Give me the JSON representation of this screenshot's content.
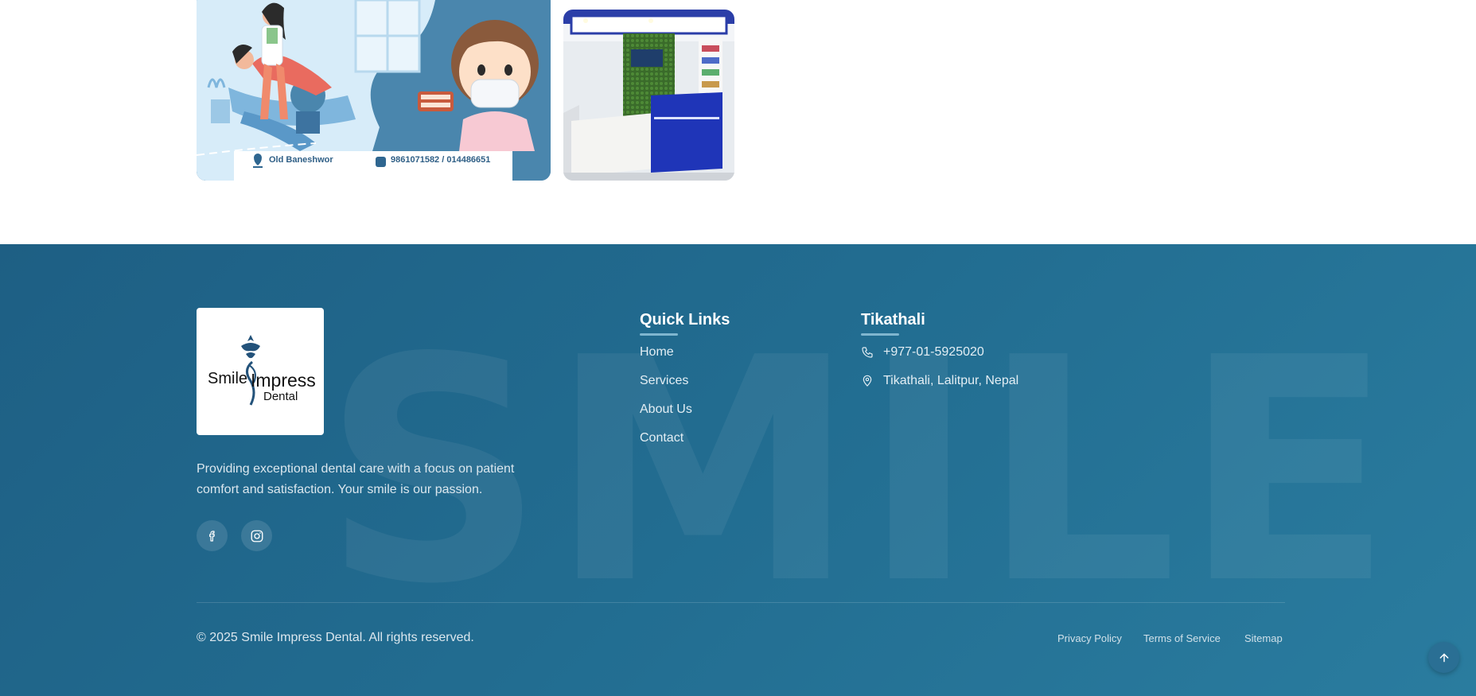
{
  "banner": {
    "location": "Old Baneshwor",
    "phones": "9861071582 / 014486651"
  },
  "footer": {
    "watermark": "SMILE",
    "logo": {
      "word1": "Smile",
      "word2": "Impress",
      "word3": "Dental"
    },
    "tagline": "Providing exceptional dental care with a focus on patient comfort and satisfaction. Your smile is our passion.",
    "social": [
      {
        "icon": "facebook-icon"
      },
      {
        "icon": "instagram-icon"
      }
    ],
    "quick_links": {
      "title": "Quick Links",
      "items": [
        "Home",
        "Services",
        "About Us",
        "Contact"
      ]
    },
    "branch": {
      "title": "Tikathali",
      "phone": "+977-01-5925020",
      "address": "Tikathali, Lalitpur, Nepal"
    },
    "copyright": "© 2025 Smile Impress Dental. All rights reserved.",
    "legal": [
      "Privacy Policy",
      "Terms of Service",
      "Sitemap"
    ]
  },
  "colors": {
    "footer_bg": "#226d91",
    "accent": "#7fb6cf"
  }
}
